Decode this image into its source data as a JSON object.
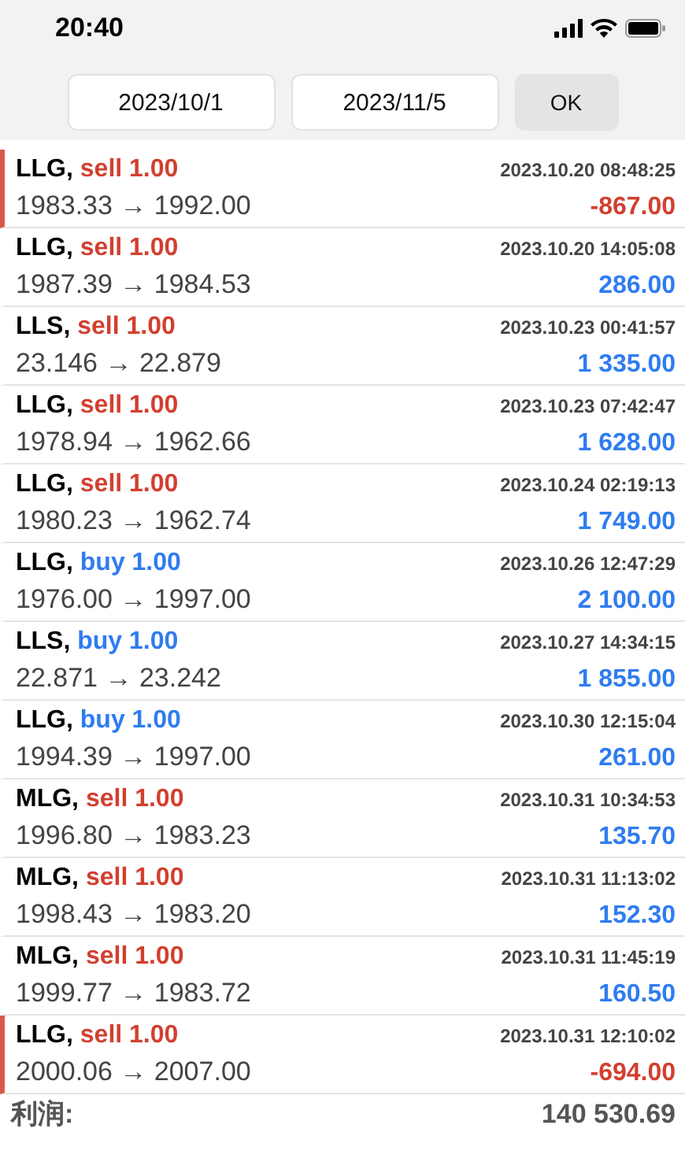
{
  "status_bar": {
    "time": "20:40"
  },
  "filter": {
    "from": "2023/10/1",
    "to": "2023/11/5",
    "button": "OK"
  },
  "trades": [
    {
      "symbol": "LLG,",
      "side": "sell",
      "volume": "1.00",
      "time": "2023.10.20 08:48:25",
      "prices": "1983.33 → 1992.00",
      "profit": "-867.00",
      "loss": true
    },
    {
      "symbol": "LLG,",
      "side": "sell",
      "volume": "1.00",
      "time": "2023.10.20 14:05:08",
      "prices": "1987.39 → 1984.53",
      "profit": "286.00",
      "loss": false
    },
    {
      "symbol": "LLS,",
      "side": "sell",
      "volume": "1.00",
      "time": "2023.10.23 00:41:57",
      "prices": "23.146 → 22.879",
      "profit": "1 335.00",
      "loss": false
    },
    {
      "symbol": "LLG,",
      "side": "sell",
      "volume": "1.00",
      "time": "2023.10.23 07:42:47",
      "prices": "1978.94 → 1962.66",
      "profit": "1 628.00",
      "loss": false
    },
    {
      "symbol": "LLG,",
      "side": "sell",
      "volume": "1.00",
      "time": "2023.10.24 02:19:13",
      "prices": "1980.23 → 1962.74",
      "profit": "1 749.00",
      "loss": false
    },
    {
      "symbol": "LLG,",
      "side": "buy",
      "volume": "1.00",
      "time": "2023.10.26 12:47:29",
      "prices": "1976.00 → 1997.00",
      "profit": "2 100.00",
      "loss": false
    },
    {
      "symbol": "LLS,",
      "side": "buy",
      "volume": "1.00",
      "time": "2023.10.27 14:34:15",
      "prices": "22.871 → 23.242",
      "profit": "1 855.00",
      "loss": false
    },
    {
      "symbol": "LLG,",
      "side": "buy",
      "volume": "1.00",
      "time": "2023.10.30 12:15:04",
      "prices": "1994.39 → 1997.00",
      "profit": "261.00",
      "loss": false
    },
    {
      "symbol": "MLG,",
      "side": "sell",
      "volume": "1.00",
      "time": "2023.10.31 10:34:53",
      "prices": "1996.80 → 1983.23",
      "profit": "135.70",
      "loss": false
    },
    {
      "symbol": "MLG,",
      "side": "sell",
      "volume": "1.00",
      "time": "2023.10.31 11:13:02",
      "prices": "1998.43 → 1983.20",
      "profit": "152.30",
      "loss": false
    },
    {
      "symbol": "MLG,",
      "side": "sell",
      "volume": "1.00",
      "time": "2023.10.31 11:45:19",
      "prices": "1999.77 → 1983.72",
      "profit": "160.50",
      "loss": false
    },
    {
      "symbol": "LLG,",
      "side": "sell",
      "volume": "1.00",
      "time": "2023.10.31 12:10:02",
      "prices": "2000.06 → 2007.00",
      "profit": "-694.00",
      "loss": true
    }
  ],
  "summary": {
    "label": "利润:",
    "value": "140 530.69"
  }
}
